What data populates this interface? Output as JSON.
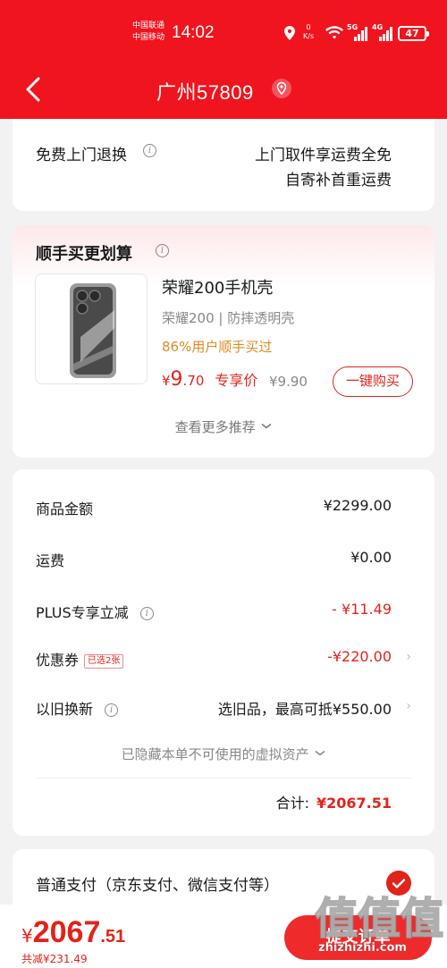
{
  "status_bar": {
    "carrier1": "中国联通",
    "carrier2": "中国移动",
    "time": "14:02",
    "speed_value": "0",
    "speed_unit": "K/s",
    "net1": "5G",
    "net2": "4G",
    "battery": "47"
  },
  "header": {
    "title": "广州57809",
    "back_icon": "chevron-left-icon",
    "location_icon": "location-pin-icon"
  },
  "return_service": {
    "label": "免费上门退换",
    "line1": "上门取件享运费全免",
    "line2": "自寄补首重运费"
  },
  "recommend": {
    "title": "顺手买更划算",
    "product_name": "荣耀200手机壳",
    "product_spec": "荣耀200 | 防摔透明壳",
    "product_hint": "86%用户顺手买过",
    "price_yen": "¥",
    "price_int": "9",
    "price_dec": ".70",
    "price_label": "专享价",
    "original_price": "¥9.90",
    "buy_label": "一键购买",
    "more_label": "查看更多推荐"
  },
  "summary": {
    "goods_label": "商品金额",
    "goods_value": "¥2299.00",
    "shipping_label": "运费",
    "shipping_value": "¥0.00",
    "plus_label": "PLUS专享立减",
    "plus_value": "- ¥11.49",
    "coupon_label": "优惠券",
    "coupon_tag": "已选2张",
    "coupon_value": "-¥220.00",
    "tradein_label": "以旧换新",
    "tradein_value": "选旧品，最高可抵¥550.00",
    "hidden_note": "已隐藏本单不可使用的虚拟资产",
    "total_label": "合计:",
    "total_value": "¥2067.51"
  },
  "payment": {
    "label": "普通支付（京东支付、微信支付等）",
    "selected": true
  },
  "bottom_bar": {
    "yen": "¥",
    "price_int": "2067",
    "price_dec": ".51",
    "saved": "共减¥231.49",
    "submit_label": "提交订单"
  },
  "watermark": {
    "glyph": "值",
    "text": "zhizhizhi.com"
  },
  "colors": {
    "brand_red": "#f0141e",
    "price_red": "#e2231a",
    "hint_orange": "#d98b24"
  }
}
